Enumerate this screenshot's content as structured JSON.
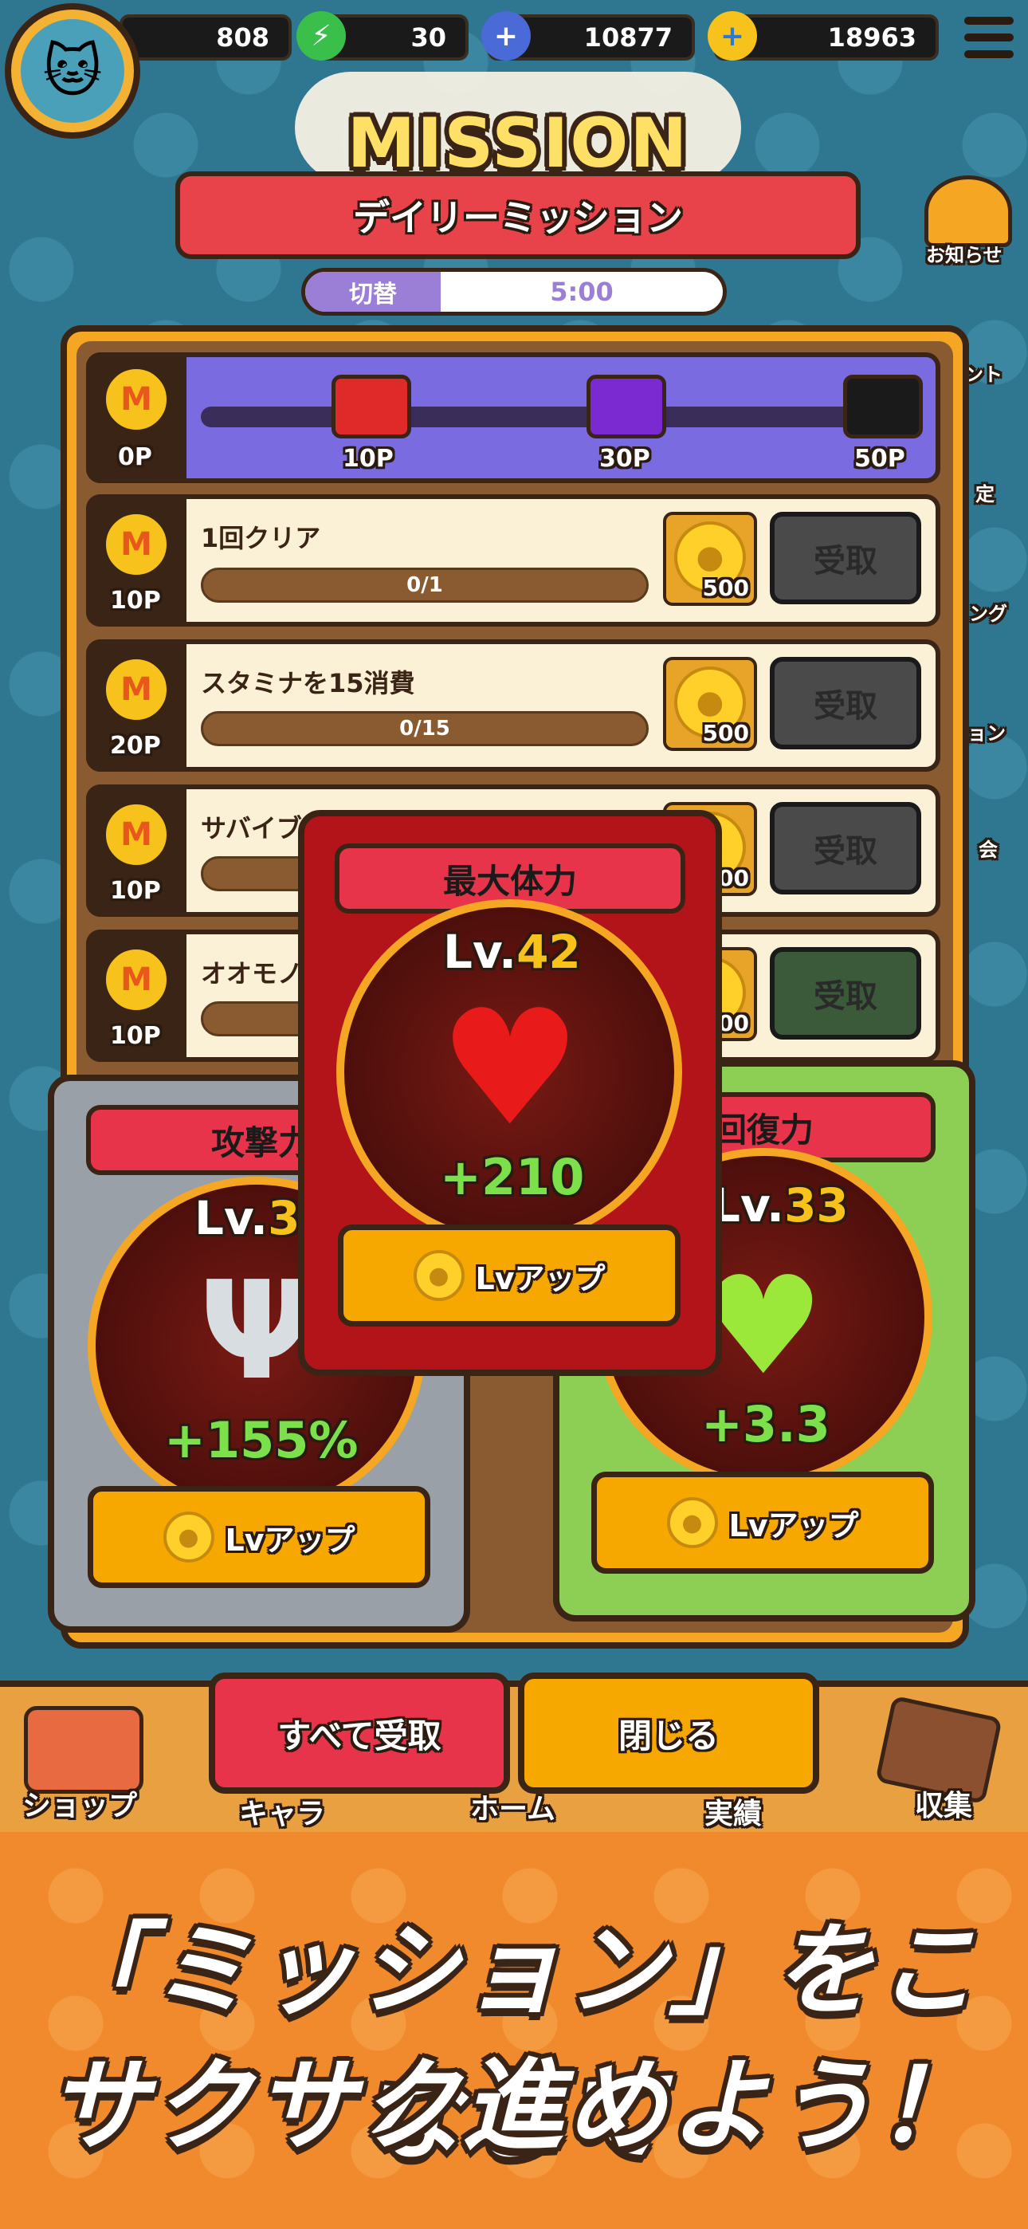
{
  "top_bar": {
    "resource1": "808",
    "stamina": "30",
    "gems": "10877",
    "coins": "18963"
  },
  "side_icons": [
    "お知らせ",
    "ント",
    "定",
    "ング",
    "ョン",
    "会"
  ],
  "header": {
    "title": "MISSION",
    "subtitle": "デイリーミッション",
    "switch_label": "切替",
    "timer": "5:00"
  },
  "progress": {
    "current": "0P",
    "milestones": [
      "10P",
      "30P",
      "50P"
    ],
    "colors": [
      "#e02a2a",
      "#7a2ad0",
      "#1a1a1a"
    ]
  },
  "missions": [
    {
      "points": "10P",
      "title": "1回クリア",
      "progress": "0/1",
      "reward": "500",
      "claim": "受取"
    },
    {
      "points": "20P",
      "title": "スタミナを15消費",
      "progress": "0/15",
      "reward": "500",
      "claim": "受取"
    },
    {
      "points": "10P",
      "title": "サバイブ",
      "progress": "",
      "reward": "500",
      "claim": "受取"
    },
    {
      "points": "10P",
      "title": "オオモノ",
      "progress": "",
      "reward": "500",
      "claim": "受取"
    }
  ],
  "coin_letter": "M",
  "upgrades": {
    "left": {
      "title": "攻撃力",
      "level_prefix": "Lv.",
      "level": "37",
      "bonus": "+155%",
      "button": "Lvアップ"
    },
    "center": {
      "title": "最大体力",
      "level_prefix": "Lv.",
      "level": "42",
      "bonus": "+210",
      "button": "Lvアップ"
    },
    "right": {
      "title": "回復力",
      "level_prefix": "Lv.",
      "level": "33",
      "bonus": "+3.3",
      "button": "Lvアップ"
    }
  },
  "nav": {
    "items": [
      "ショップ",
      "キャラ",
      "ホーム",
      "実績",
      "収集"
    ]
  },
  "actions": {
    "claim_all": "すべて受取",
    "close": "閉じる"
  },
  "promo": {
    "line1": "「ミッション」をこなして",
    "line2": "サクサク進めよう！"
  }
}
